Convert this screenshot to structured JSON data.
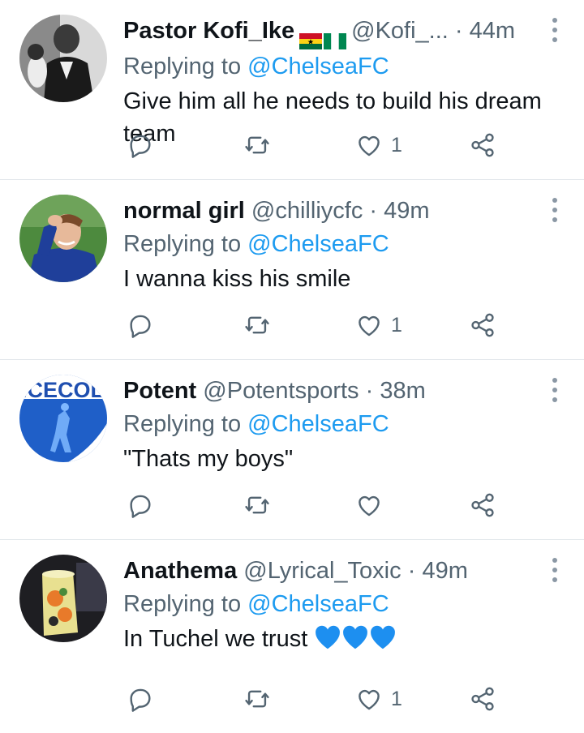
{
  "tweets": [
    {
      "name": "Pastor Kofi_Ike",
      "flags": [
        "ghana-flag",
        "nigeria-flag"
      ],
      "handle": "@Kofi_...",
      "dot": "·",
      "time": "44m",
      "replying_prefix": "Replying to ",
      "replying_to": "@ChelseaFC",
      "text": "Give him all he needs to build his dream team",
      "likes": "1",
      "avatar": "avatar-man-suit-bw"
    },
    {
      "name": "normal girl",
      "handle": "@chilliycfc",
      "dot": "·",
      "time": "49m",
      "replying_prefix": "Replying to ",
      "replying_to": "@ChelseaFC",
      "text": "I wanna kiss his smile",
      "likes": "1",
      "avatar": "avatar-player-blue-kit"
    },
    {
      "name": "Potent",
      "handle": "@Potentsports",
      "dot": "·",
      "time": "38m",
      "replying_prefix": "Replying to ",
      "replying_to": "@ChelseaFC",
      "text": "\"Thats my boys\"",
      "likes": "",
      "avatar": "avatar-icecold-blue",
      "avatar_text": "ICECOLD"
    },
    {
      "name": "Anathema",
      "handle": "@Lyrical_Toxic",
      "dot": "·",
      "time": "49m",
      "replying_prefix": "Replying to ",
      "replying_to": "@ChelseaFC",
      "text": "In Tuchel we trust ",
      "emoji": [
        "blue-heart",
        "blue-heart",
        "blue-heart"
      ],
      "likes": "1",
      "avatar": "avatar-cup-drink"
    }
  ],
  "colors": {
    "text": "#0f1419",
    "secondary": "#536471",
    "link": "#1d9bf0",
    "divider": "#e1e6ea",
    "heart_emoji": "#1d8ff0"
  },
  "icons": [
    "reply-icon",
    "retweet-icon",
    "like-icon",
    "share-icon",
    "more-icon"
  ]
}
